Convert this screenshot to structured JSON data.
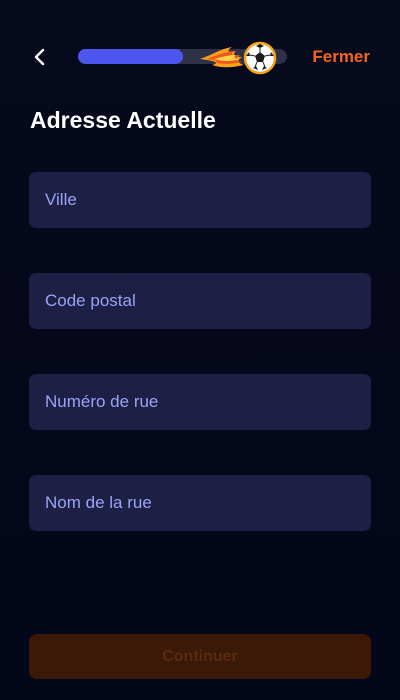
{
  "header": {
    "close_label": "Fermer",
    "progress": 0.5
  },
  "page": {
    "title": "Adresse Actuelle"
  },
  "form": {
    "fields": [
      {
        "placeholder": "Ville",
        "value": ""
      },
      {
        "placeholder": "Code postal",
        "value": ""
      },
      {
        "placeholder": "Numéro de rue",
        "value": ""
      },
      {
        "placeholder": "Nom de la rue",
        "value": ""
      }
    ]
  },
  "footer": {
    "continue_label": "Continuer"
  },
  "colors": {
    "accent": "#f2641f",
    "progress_fill": "#4c56ee",
    "field_bg": "#1d1f45",
    "placeholder": "#9aa3f5",
    "disabled_btn_bg": "#3a1a07"
  },
  "icons": {
    "back": "chevron-left-icon",
    "progress_marker": "flaming-soccer-ball-icon"
  }
}
